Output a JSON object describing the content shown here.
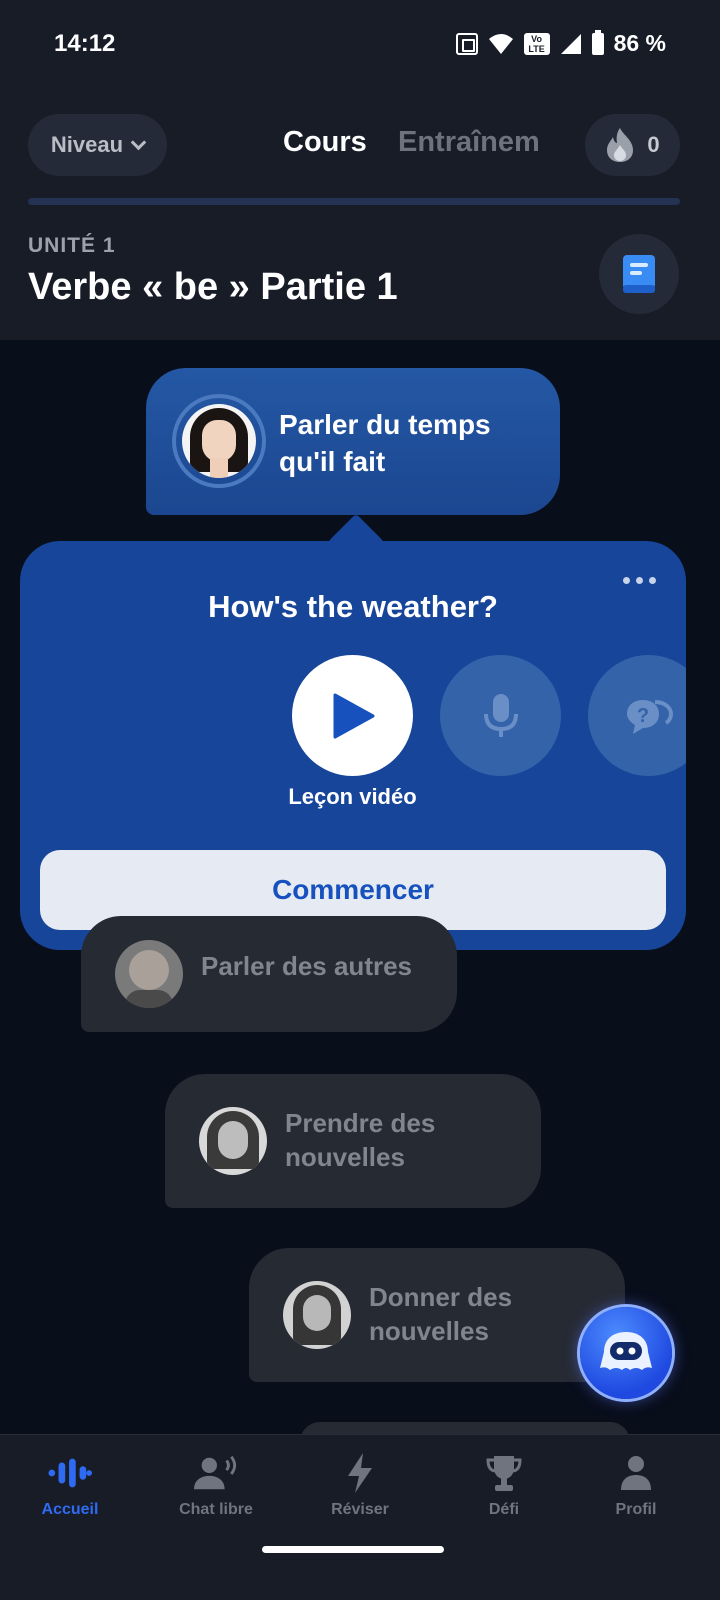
{
  "status_bar": {
    "time": "14:12",
    "battery": "86 %"
  },
  "header": {
    "level_label": "Niveau",
    "tabs": [
      "Cours",
      "Entraînem"
    ],
    "streak_count": "0"
  },
  "unit": {
    "label": "UNITÉ 1",
    "title": "Verbe « be » Partie 1"
  },
  "active_lesson": {
    "title": "Parler du temps qu'il fait"
  },
  "popup": {
    "title": "How's the weather?",
    "step_label": "Leçon vidéo",
    "start_button": "Commencer"
  },
  "lessons": [
    {
      "title": "Parler des autres"
    },
    {
      "title": "Prendre des nouvelles"
    },
    {
      "title": "Donner des nouvelles"
    }
  ],
  "bottom_nav": [
    {
      "label": "Accueil",
      "icon": "home-wave-icon",
      "active": true
    },
    {
      "label": "Chat libre",
      "icon": "speaking-person-icon"
    },
    {
      "label": "Réviser",
      "icon": "lightning-icon"
    },
    {
      "label": "Défi",
      "icon": "trophy-icon"
    },
    {
      "label": "Profil",
      "icon": "person-icon"
    }
  ],
  "colors": {
    "accent": "#2e6bf2",
    "popup": "#16459a",
    "background": "#090e1b"
  }
}
